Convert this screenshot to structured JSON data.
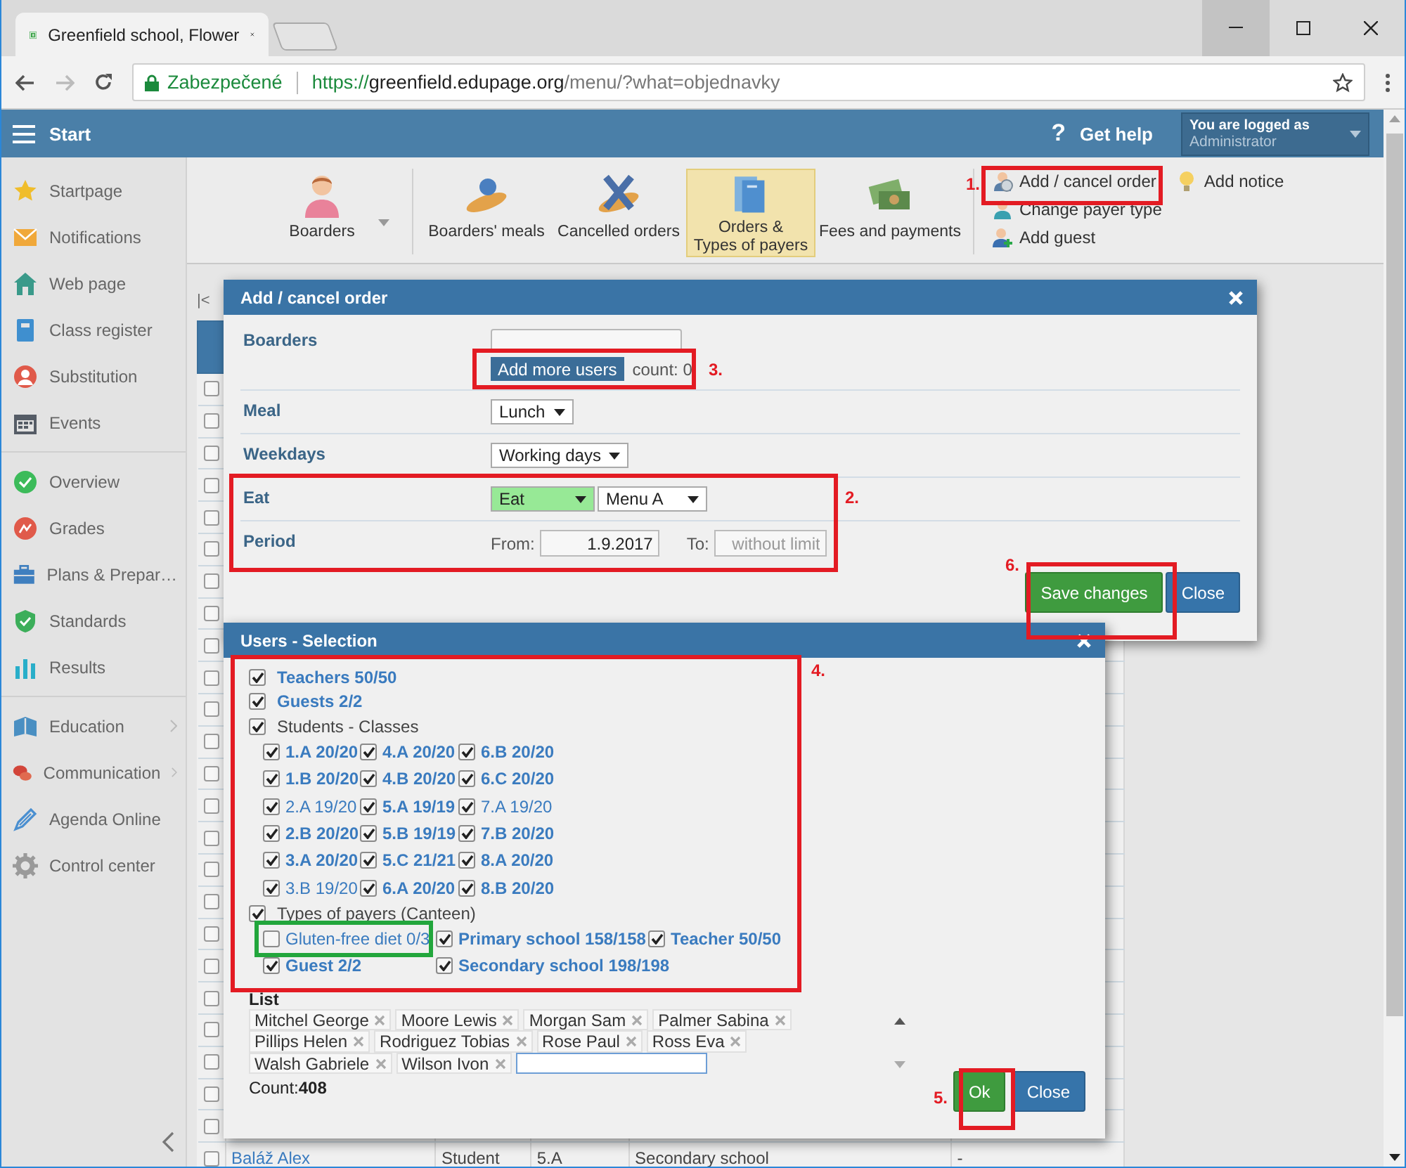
{
  "browser": {
    "tab_title": "Greenfield school, Flower",
    "security_label": "Zabezpečené",
    "url_scheme": "https://",
    "url_host": "greenfield.edupage.org",
    "url_path": "/menu/?what=objednavky"
  },
  "header": {
    "menu_label": "Start",
    "help_icon": "?",
    "help_label": "Get help",
    "login_caption": "You are logged as",
    "login_user": "Administrator"
  },
  "sidebar": {
    "groups": [
      {
        "items": [
          {
            "label": "Startpage",
            "submenu": false
          },
          {
            "label": "Notifications",
            "submenu": false
          },
          {
            "label": "Web page",
            "submenu": false
          },
          {
            "label": "Class register",
            "submenu": false
          },
          {
            "label": "Substitution",
            "submenu": false
          },
          {
            "label": "Events",
            "submenu": false
          }
        ]
      },
      {
        "items": [
          {
            "label": "Overview",
            "submenu": false
          },
          {
            "label": "Grades",
            "submenu": false
          },
          {
            "label": "Plans & Prepar…",
            "submenu": false
          },
          {
            "label": "Standards",
            "submenu": false
          },
          {
            "label": "Results",
            "submenu": false
          }
        ]
      },
      {
        "items": [
          {
            "label": "Education",
            "submenu": true
          },
          {
            "label": "Communication",
            "submenu": true
          },
          {
            "label": "Agenda Online",
            "submenu": false
          },
          {
            "label": "Control center",
            "submenu": false
          }
        ]
      }
    ]
  },
  "toolbar": {
    "modules": [
      {
        "label": "Boarders",
        "selected": false,
        "dropdown": true
      },
      {
        "label": "Boarders' meals",
        "selected": false,
        "dropdown": false
      },
      {
        "label": "Cancelled orders",
        "selected": false,
        "dropdown": false
      },
      {
        "label": "Orders &\nTypes of payers",
        "selected": true,
        "dropdown": false
      },
      {
        "label": "Fees and payments",
        "selected": false,
        "dropdown": false
      }
    ],
    "actions": [
      {
        "label": "Add / cancel order"
      },
      {
        "label": "Change payer type"
      },
      {
        "label": "Add guest"
      },
      {
        "label": "Add notice"
      }
    ]
  },
  "table": {
    "pager": "|<",
    "rows": [
      {
        "checked": false
      },
      {
        "checked": false
      },
      {
        "checked": false
      },
      {
        "checked": false
      },
      {
        "checked": false
      },
      {
        "checked": false
      },
      {
        "checked": false
      },
      {
        "checked": false
      },
      {
        "checked": false
      },
      {
        "checked": false
      },
      {
        "checked": false
      },
      {
        "checked": false
      },
      {
        "checked": false
      },
      {
        "checked": false
      },
      {
        "checked": false
      },
      {
        "checked": false
      },
      {
        "checked": false
      },
      {
        "checked": false
      },
      {
        "checked": false
      },
      {
        "checked": false
      },
      {
        "checked": false
      },
      {
        "checked": false
      },
      {
        "checked": false
      },
      {
        "checked": false
      },
      {
        "checked": false,
        "cells": [
          "Baláž Alex",
          "Student",
          "5.A",
          "Secondary school",
          "-"
        ]
      }
    ]
  },
  "order_dialog": {
    "title": "Add / cancel order",
    "fields": [
      {
        "kind": "users",
        "label": "Boarders",
        "button": "Add more users",
        "count": "count: 0"
      },
      {
        "kind": "select",
        "label": "Meal",
        "value": "Lunch"
      },
      {
        "kind": "select",
        "label": "Weekdays",
        "value": "Working days"
      },
      {
        "kind": "selects",
        "label": "Eat",
        "selects": [
          {
            "value": "Eat",
            "highlighted": true
          },
          {
            "value": "Menu A",
            "highlighted": false
          }
        ]
      },
      {
        "kind": "period",
        "label": "Period",
        "from_label": "From:",
        "from_value": "1.9.2017",
        "to_label": "To:",
        "to_placeholder": "without limit"
      }
    ],
    "buttons": [
      {
        "label": "Save changes",
        "kind": "primary"
      },
      {
        "label": "Close",
        "kind": "secondary"
      }
    ]
  },
  "users_dialog": {
    "title": "Users - Selection",
    "entries": [
      {
        "kind": "item",
        "label": "Teachers 50/50",
        "checked": true,
        "complete": true
      },
      {
        "kind": "item",
        "label": "Guests 2/2",
        "checked": true,
        "complete": true
      },
      {
        "kind": "classes",
        "label": "Students - Classes",
        "checked": true,
        "children": [
          {
            "label": "1.A 20/20",
            "checked": true,
            "complete": true
          },
          {
            "label": "4.A 20/20",
            "checked": true,
            "complete": true
          },
          {
            "label": "6.B 20/20",
            "checked": true,
            "complete": true
          },
          {
            "label": "1.B 20/20",
            "checked": true,
            "complete": true
          },
          {
            "label": "4.B 20/20",
            "checked": true,
            "complete": true
          },
          {
            "label": "6.C 20/20",
            "checked": true,
            "complete": true
          },
          {
            "label": "2.A 19/20",
            "checked": true,
            "complete": false
          },
          {
            "label": "5.A 19/19",
            "checked": true,
            "complete": true
          },
          {
            "label": "7.A 19/20",
            "checked": true,
            "complete": false
          },
          {
            "label": "2.B 20/20",
            "checked": true,
            "complete": true
          },
          {
            "label": "5.B 19/19",
            "checked": true,
            "complete": true
          },
          {
            "label": "7.B 20/20",
            "checked": true,
            "complete": true
          },
          {
            "label": "3.A 20/20",
            "checked": true,
            "complete": true
          },
          {
            "label": "5.C 21/21",
            "checked": true,
            "complete": true
          },
          {
            "label": "8.A 20/20",
            "checked": true,
            "complete": true
          },
          {
            "label": "3.B 19/20",
            "checked": true,
            "complete": false
          },
          {
            "label": "6.A 20/20",
            "checked": true,
            "complete": true
          },
          {
            "label": "8.B 20/20",
            "checked": true,
            "complete": true
          }
        ]
      },
      {
        "kind": "payers",
        "label": "Types of payers (Canteen)",
        "checked": true,
        "children": [
          {
            "label": "Gluten-free diet 0/3",
            "checked": false,
            "complete": false
          },
          {
            "label": "Primary school 158/158",
            "checked": true,
            "complete": true
          },
          {
            "label": "Teacher 50/50",
            "checked": true,
            "complete": true
          },
          {
            "label": "Guest 2/2",
            "checked": true,
            "complete": true
          },
          {
            "label": "Secondary school 198/198",
            "checked": true,
            "complete": true
          }
        ]
      }
    ],
    "list_label": "List",
    "chips": [
      "Mitchel George",
      "Moore Lewis",
      "Morgan Sam",
      "Palmer Sabina",
      "Pillips Helen",
      "Rodriguez Tobias",
      "Rose Paul",
      "Ross Eva",
      "Walsh Gabriele",
      "Wilson Ivon"
    ],
    "count": "Count:**408**",
    "buttons": [
      {
        "label": "Ok",
        "kind": "primary"
      },
      {
        "label": "Close",
        "kind": "secondary"
      }
    ]
  },
  "annotations": [
    {
      "label": "1.",
      "color": "#e31b23"
    },
    {
      "label": "2.",
      "color": "#e31b23"
    },
    {
      "label": "3.",
      "color": "#e31b23"
    },
    {
      "label": "4.",
      "color": "#e31b23"
    },
    {
      "label": "5.",
      "color": "#e31b23"
    },
    {
      "label": "6.",
      "color": "#e31b23"
    },
    {
      "color": "#22a63c"
    }
  ]
}
